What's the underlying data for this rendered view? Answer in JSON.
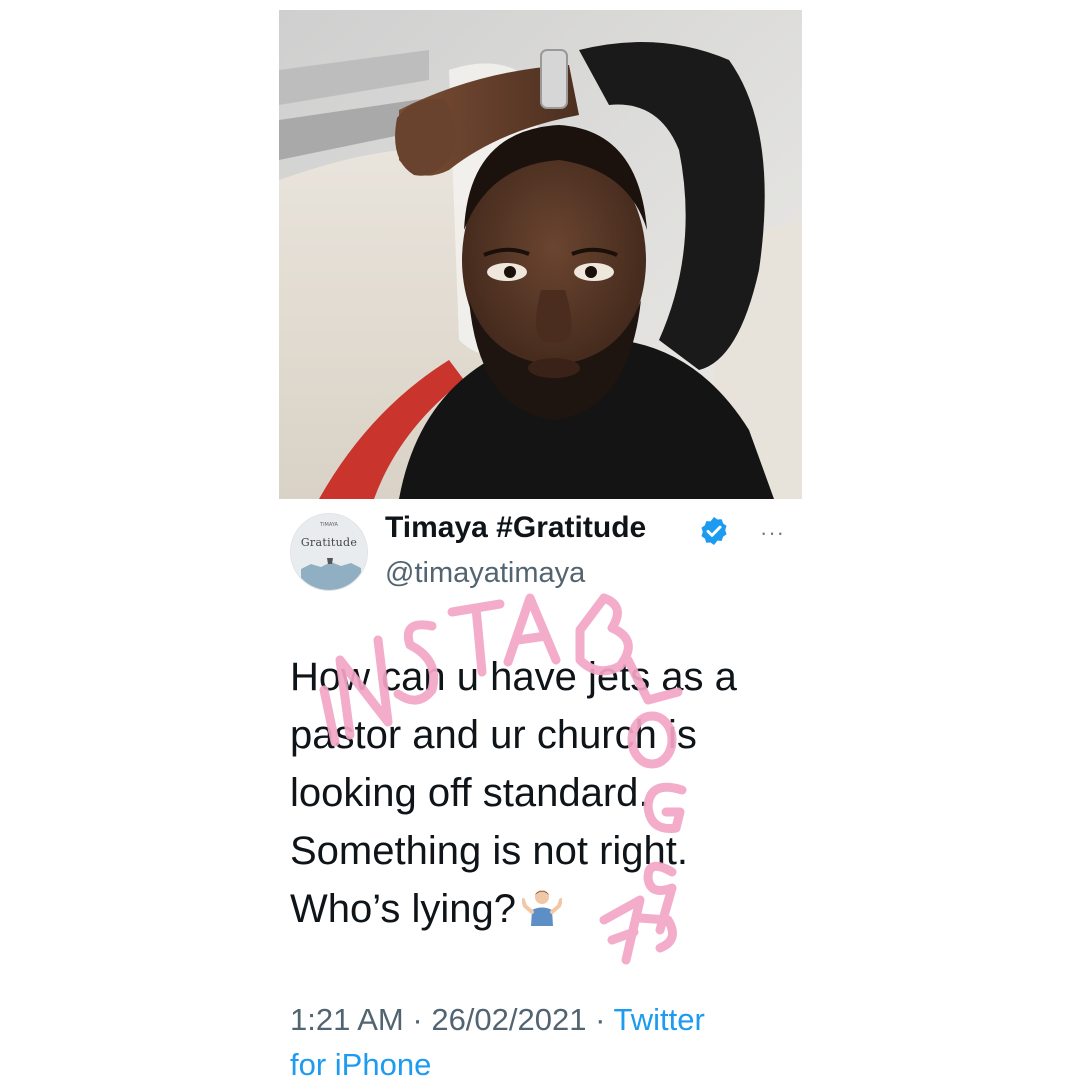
{
  "tweet": {
    "display_name": "Timaya #Gratitude",
    "handle": "@timayatimaya",
    "avatar_text": "Gratitude",
    "avatar_small_text": "TIMAYA",
    "more_label": "···",
    "text_lines": [
      "How can u have jets as a",
      "pastor and ur church is",
      "looking off standard.",
      "Something is not right.",
      "Who’s lying?"
    ],
    "time": "1:21 AM",
    "separator": "·",
    "date": "26/02/2021",
    "source_line1": "Twitter",
    "source_line2": "for iPhone"
  },
  "watermark": {
    "text": "INSTABLOG9JA",
    "color": "#f2a6c6"
  },
  "icons": {
    "verified": "verified-badge-icon",
    "more": "more-options-icon",
    "emoji": "person-shrugging-emoji"
  },
  "colors": {
    "text_primary": "#0f1419",
    "text_secondary": "#536471",
    "accent": "#1d9bf0"
  }
}
